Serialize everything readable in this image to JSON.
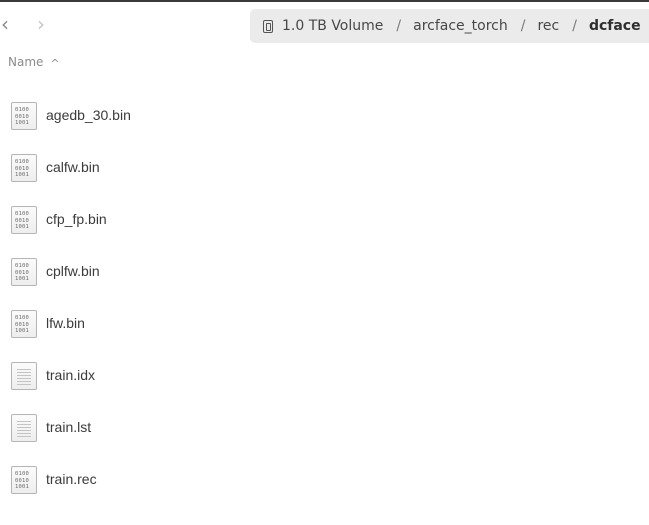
{
  "toolbar": {
    "back_icon": "chevron-left-icon",
    "forward_icon": "chevron-right-icon"
  },
  "pathbar": {
    "drive_icon": "drive-icon",
    "segments": [
      "1.0 TB Volume",
      "arcface_torch",
      "rec",
      "dcface"
    ],
    "separator": "/"
  },
  "list_header": {
    "name_label": "Name",
    "sort_direction": "ascending"
  },
  "files": [
    {
      "name": "agedb_30.bin",
      "icon": "binary-file-icon"
    },
    {
      "name": "calfw.bin",
      "icon": "binary-file-icon"
    },
    {
      "name": "cfp_fp.bin",
      "icon": "binary-file-icon"
    },
    {
      "name": "cplfw.bin",
      "icon": "binary-file-icon"
    },
    {
      "name": "lfw.bin",
      "icon": "binary-file-icon"
    },
    {
      "name": "train.idx",
      "icon": "text-file-icon"
    },
    {
      "name": "train.lst",
      "icon": "text-file-icon"
    },
    {
      "name": "train.rec",
      "icon": "binary-file-icon"
    }
  ]
}
